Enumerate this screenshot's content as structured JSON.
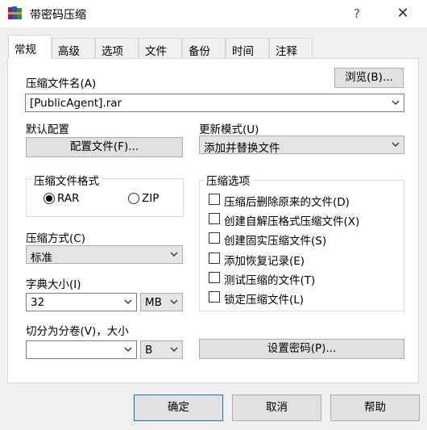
{
  "window": {
    "title": "带密码压缩",
    "help": "?",
    "close": "✕"
  },
  "tabs": [
    {
      "label": "常规",
      "active": true
    },
    {
      "label": "高级",
      "active": false
    },
    {
      "label": "选项",
      "active": false
    },
    {
      "label": "文件",
      "active": false
    },
    {
      "label": "备份",
      "active": false
    },
    {
      "label": "时间",
      "active": false
    },
    {
      "label": "注释",
      "active": false
    }
  ],
  "general": {
    "archive_name_label": "压缩文件名(A)",
    "browse_button": "浏览(B)...",
    "archive_name_value": "[PublicAgent].rar",
    "default_profile_label": "默认配置",
    "profiles_button": "配置文件(F)...",
    "update_mode_label": "更新模式(U)",
    "update_mode_value": "添加并替换文件",
    "format_group_title": "压缩文件格式",
    "format_rar": "RAR",
    "format_zip": "ZIP",
    "format_selected": "RAR",
    "method_label": "压缩方式(C)",
    "method_value": "标准",
    "dict_label": "字典大小(I)",
    "dict_value": "32",
    "dict_unit": "MB",
    "split_label": "切分为分卷(V)，大小",
    "split_value": "",
    "split_unit": "B",
    "options_group_title": "压缩选项",
    "options": [
      {
        "label": "压缩后删除原来的文件(D)",
        "checked": false
      },
      {
        "label": "创建自解压格式压缩文件(X)",
        "checked": false
      },
      {
        "label": "创建固实压缩文件(S)",
        "checked": false
      },
      {
        "label": "添加恢复记录(E)",
        "checked": false
      },
      {
        "label": "测试压缩的文件(T)",
        "checked": false
      },
      {
        "label": "锁定压缩文件(L)",
        "checked": false
      }
    ],
    "set_password_button": "设置密码(P)..."
  },
  "footer": {
    "ok": "确定",
    "cancel": "取消",
    "help": "帮助"
  },
  "colors": {
    "window_bg": "#f0f0f0",
    "panel_bg": "#ffffff",
    "button_bg": "#e1e1e1",
    "button_border": "#adadad",
    "default_button_border": "#0078d7"
  },
  "icons": {
    "app": "winrar-books-icon",
    "dropdown": "chevron-down-icon"
  }
}
